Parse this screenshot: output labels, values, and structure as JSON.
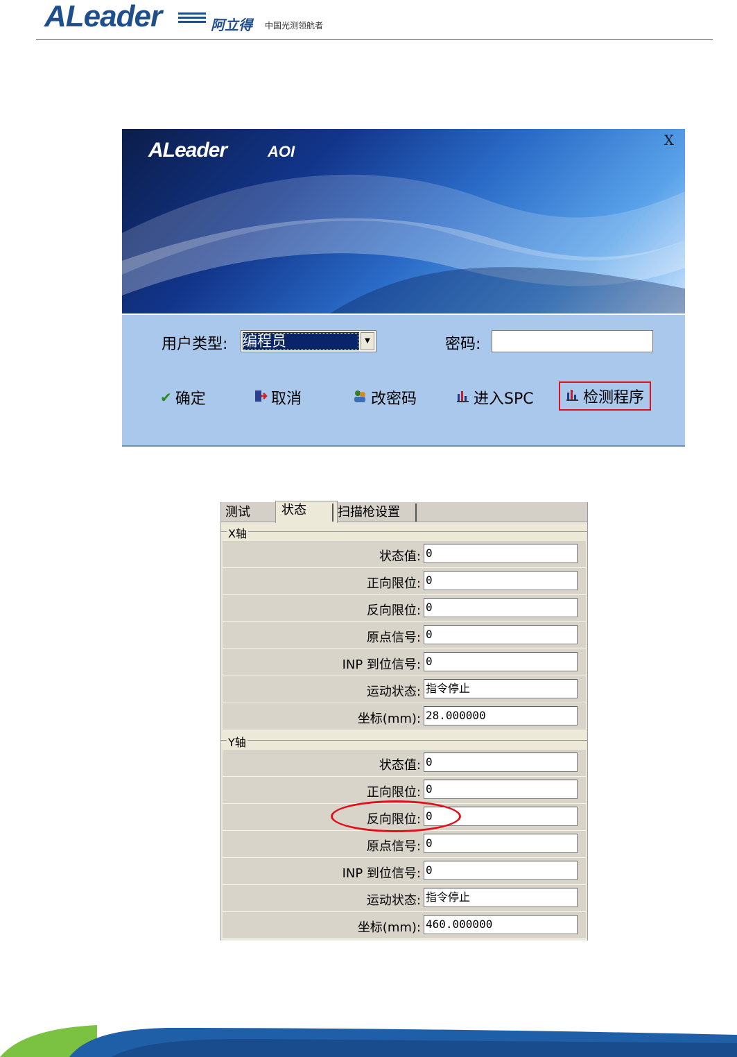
{
  "header": {
    "logo_text": "ALeader",
    "logo_cn": "阿立得",
    "slogan": "中国光测领航者"
  },
  "login": {
    "banner_logo": "ALeader",
    "banner_product": "AOI",
    "close_label": "X",
    "user_type_label": "用户类型:",
    "user_type_value": "编程员",
    "password_label": "密码:",
    "password_value": "",
    "buttons": {
      "ok": "确定",
      "cancel": "取消",
      "change_password": "改密码",
      "enter_spc": "进入SPC",
      "inspect_program": "检测程序"
    },
    "highlight_color": "#e0101a"
  },
  "panel": {
    "tabs": [
      "测试",
      "状态",
      "扫描枪设置"
    ],
    "active_tab": "状态",
    "x_axis": {
      "title": "X轴",
      "rows": [
        {
          "label": "状态值:",
          "value": "0"
        },
        {
          "label": "正向限位:",
          "value": "0"
        },
        {
          "label": "反向限位:",
          "value": "0"
        },
        {
          "label": "原点信号:",
          "value": "0"
        },
        {
          "label": "INP 到位信号:",
          "value": "0"
        },
        {
          "label": "运动状态:",
          "value": "指令停止"
        },
        {
          "label": "坐标(mm):",
          "value": "28.000000"
        }
      ]
    },
    "y_axis": {
      "title": "Y轴",
      "rows": [
        {
          "label": "状态值:",
          "value": "0"
        },
        {
          "label": "正向限位:",
          "value": "0"
        },
        {
          "label": "反向限位:",
          "value": "0"
        },
        {
          "label": "原点信号:",
          "value": "0"
        },
        {
          "label": "INP 到位信号:",
          "value": "0"
        },
        {
          "label": "运动状态:",
          "value": "指令停止"
        },
        {
          "label": "坐标(mm):",
          "value": "460.000000"
        }
      ]
    }
  },
  "icons": {
    "ok": "checkmark-icon",
    "cancel": "exit-door-icon",
    "change_password": "users-key-icon",
    "enter_spc": "bar-chart-icon",
    "inspect_program": "bar-chart-icon"
  }
}
